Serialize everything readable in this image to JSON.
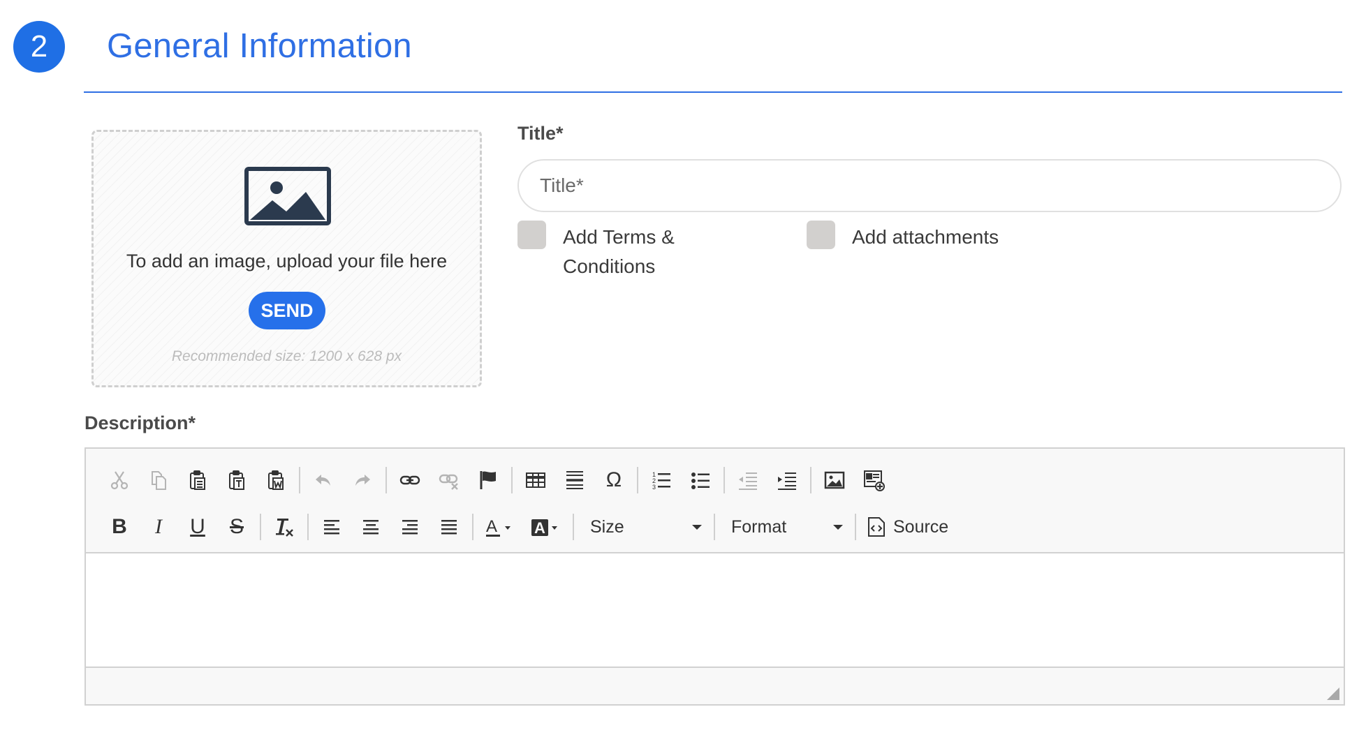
{
  "step": {
    "number": "2",
    "title": "General Information"
  },
  "upload": {
    "instruction": "To add an image, upload your file here",
    "send_label": "SEND",
    "hint": "Recommended size: 1200 x 628 px"
  },
  "title_field": {
    "label": "Title*",
    "placeholder": "Title*",
    "value": ""
  },
  "checkboxes": [
    {
      "label_line1": "Add Terms &",
      "label_line2": "Conditions",
      "checked": false
    },
    {
      "label": "Add attachments",
      "checked": false
    }
  ],
  "description": {
    "label": "Description*",
    "toolbar": {
      "size_label": "Size",
      "format_label": "Format",
      "source_label": "Source"
    },
    "content": ""
  },
  "colors": {
    "accent": "#2f6fe4",
    "button": "#2670ea",
    "checkbox": "#d2d0ce"
  }
}
